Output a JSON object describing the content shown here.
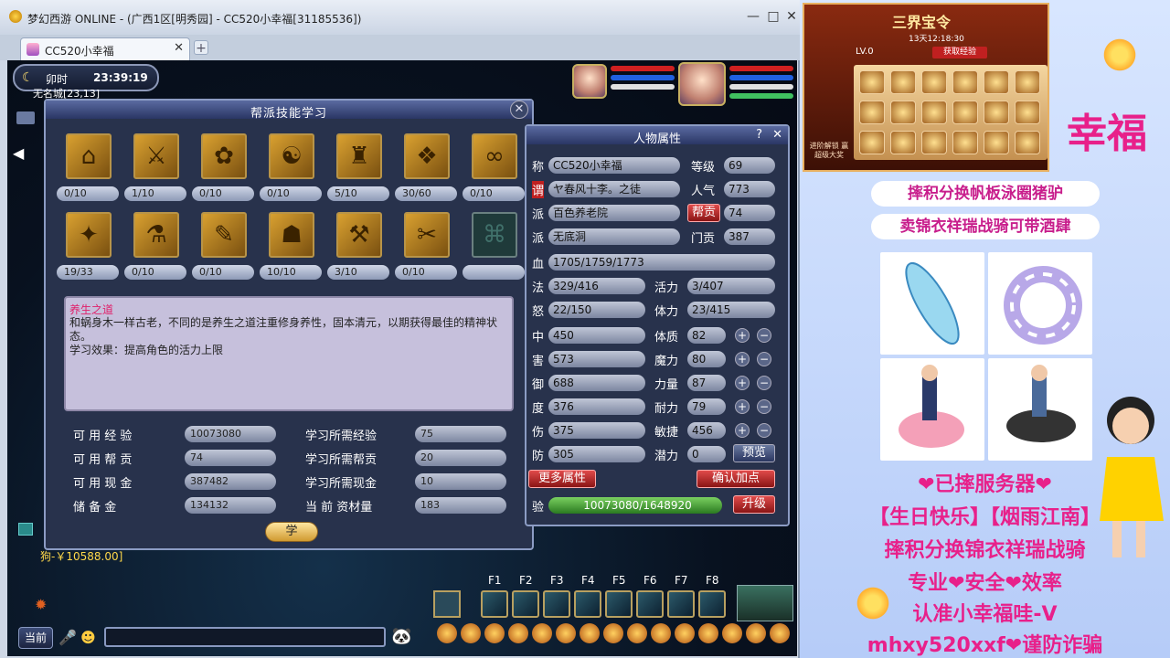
{
  "window": {
    "title": "梦幻西游 ONLINE - (广西1区[明秀园] - CC520小幸福[31185536])",
    "tab_label": "CC520小幸福"
  },
  "hud": {
    "period": "卯时",
    "time": "23:39:19",
    "location": "无名城[23,13]",
    "money": "狗-￥10588.00]",
    "now_btn": "当前"
  },
  "skill_dialog": {
    "title": "帮派技能学习",
    "row1": [
      {
        "glyph": "⌂",
        "level": "0/10"
      },
      {
        "glyph": "⚔",
        "level": "1/10"
      },
      {
        "glyph": "✿",
        "level": "0/10"
      },
      {
        "glyph": "☯",
        "level": "0/10"
      },
      {
        "glyph": "♜",
        "level": "5/10"
      },
      {
        "glyph": "❖",
        "level": "30/60"
      },
      {
        "glyph": "∞",
        "level": "0/10"
      }
    ],
    "row2": [
      {
        "glyph": "✦",
        "level": "19/33"
      },
      {
        "glyph": "⚗",
        "level": "0/10"
      },
      {
        "glyph": "✎",
        "level": "0/10"
      },
      {
        "glyph": "☗",
        "level": "10/10"
      },
      {
        "glyph": "⚒",
        "level": "3/10"
      },
      {
        "glyph": "✂",
        "level": "0/10"
      },
      {
        "glyph": "⌘",
        "level": ""
      }
    ],
    "desc_title": "养生之道",
    "desc_body": "和蜗身木一样古老，不同的是养生之道注重修身养性，固本清元，以期获得最佳的精神状态。",
    "desc_effect": "学习效果：提高角色的活力上限",
    "labels": {
      "exp": "可 用 经 验",
      "contrib": "可 用 帮 贡",
      "cash": "可 用 现 金",
      "reserve": "储   备   金",
      "need_exp": "学习所需经验",
      "need_contrib": "学习所需帮贡",
      "need_cash": "学习所需现金",
      "material": "当 前 资材量"
    },
    "values": {
      "exp": "10073080",
      "contrib": "74",
      "cash": "387482",
      "reserve": "134132",
      "need_exp": "75",
      "need_contrib": "20",
      "need_cash": "10",
      "material": "183"
    },
    "learn_btn": "学"
  },
  "char_panel": {
    "title": "人物属性",
    "help": "?",
    "close": "✕",
    "name_lbl": "称",
    "name": "CC520小幸福",
    "level_lbl": "等级",
    "level": "69",
    "title_lbl": "谓",
    "title_val": "ヤ春风十李。之徒",
    "pop_lbl": "人气",
    "pop": "773",
    "guild_lbl": "派",
    "guild": "百色养老院",
    "gcontrib_btn": "帮贡",
    "gcontrib": "74",
    "school_lbl": "派",
    "school": "无底洞",
    "scontrib_lbl": "门贡",
    "scontrib": "387",
    "hp_lbl": "血",
    "hp": "1705/1759/1773",
    "mp_lbl": "法",
    "mp": "329/416",
    "vit_lbl": "活力",
    "vit": "3/407",
    "anger_lbl": "怒",
    "anger": "22/150",
    "stam_lbl": "体力",
    "stam": "23/415",
    "stats": [
      {
        "l": "中",
        "v": "450",
        "al": "体质",
        "av": "82"
      },
      {
        "l": "害",
        "v": "573",
        "al": "魔力",
        "av": "80"
      },
      {
        "l": "御",
        "v": "688",
        "al": "力量",
        "av": "87"
      },
      {
        "l": "度",
        "v": "376",
        "al": "耐力",
        "av": "79"
      },
      {
        "l": "伤",
        "v": "375",
        "al": "敏捷",
        "av": "456"
      }
    ],
    "def_lbl": "防",
    "def": "305",
    "pot_lbl": "潜力",
    "pot": "0",
    "preview_btn": "预览",
    "more_btn": "更多属性",
    "confirm_btn": "确认加点",
    "exp_lbl": "验",
    "exp": "10073080/1648920",
    "upgrade_btn": "升级"
  },
  "hotkeys": [
    "F1",
    "F2",
    "F3",
    "F4",
    "F5",
    "F6",
    "F7",
    "F8"
  ],
  "overlay": {
    "promo_title": "三界宝令",
    "promo_date": "13天12:18:30",
    "promo_lv": "LV.0",
    "promo_get": "获取经验",
    "promo_side": "进阶解锁 赢超级大奖",
    "banner1": "摔积分换帆板泳圈猪驴",
    "banner2": "卖锦衣祥瑞战骑可带酒肆",
    "line1": "❤已摔服务器❤",
    "line2": "【生日快乐】【烟雨江南】",
    "line3": "摔积分换锦衣祥瑞战骑",
    "line4": "专业❤安全❤效率",
    "line5": "认准小幸福哇-V",
    "line6": "mhxy520xxf❤谨防诈骗",
    "fu": "幸福"
  }
}
